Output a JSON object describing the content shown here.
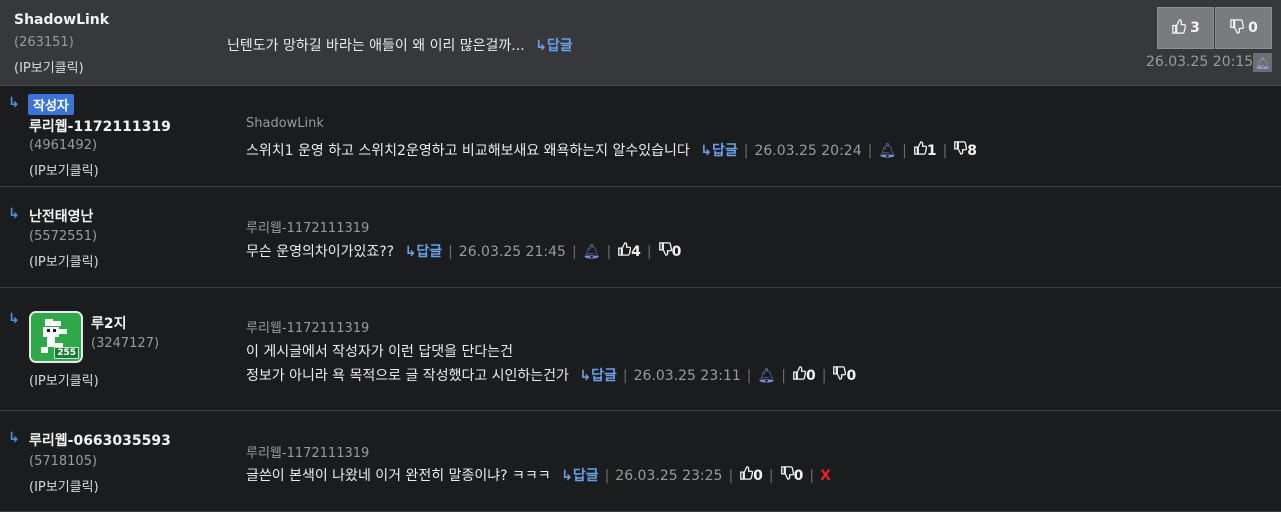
{
  "main_post": {
    "nick": "ShadowLink",
    "uid": "(263151)",
    "ip": "(IP보기클릭)",
    "text": "닌텐도가 망하길 바라는 애들이 왜 이리 많은걸까...",
    "reply_label": "답글",
    "up_count": "3",
    "down_count": "0",
    "date": "26.03.25 20:15"
  },
  "comments": [
    {
      "badge": "작성자",
      "nick": "루리웹-1172111319",
      "uid": "(4961492)",
      "ip": "(IP보기클릭)",
      "parent": "ShadowLink",
      "text_lines": [
        "스위치1 운영 하고 스위치2운영하고 비교해보새요 왜욕하는지 알수있습니다"
      ],
      "reply_label": "답글",
      "date": "26.03.25 20:24",
      "up": "1",
      "down": "8"
    },
    {
      "nick": "난전태영난",
      "uid": "(5572551)",
      "ip": "(IP보기클릭)",
      "parent": "루리웹-1172111319",
      "text_lines": [
        "무슨 운영의차이가있죠??"
      ],
      "reply_label": "답글",
      "date": "26.03.25 21:45",
      "up": "4",
      "down": "0"
    },
    {
      "nick": "루2지",
      "uid": "(3247127)",
      "ip": "(IP보기클릭)",
      "avatar_level": "255",
      "parent": "루리웹-1172111319",
      "text_lines": [
        "이 게시글에서 작성자가 이런 답댓을 단다는건",
        "정보가 아니라 욕 목적으로 글 작성했다고 시인하는건가"
      ],
      "reply_label": "답글",
      "date": "26.03.25 23:11",
      "up": "0",
      "down": "0"
    },
    {
      "nick": "루리웹-0663035593",
      "uid": "(5718105)",
      "ip": "(IP보기클릭)",
      "parent": "루리웹-1172111319",
      "text_lines": [
        "글쓴이 본색이 나왔네 이거 완전히 말종이냐? ㅋㅋㅋ"
      ],
      "reply_label": "답글",
      "date": "26.03.25 23:25",
      "up": "0",
      "down": "0",
      "delete_label": "X"
    }
  ],
  "icons": {
    "reply_arrow": "reply-arrow-icon",
    "thumb_up": "thumbs-up-icon",
    "thumb_down": "thumbs-down-icon",
    "bell": "report-bell-icon"
  },
  "colors": {
    "accent": "#6aa0e8",
    "badge": "#3b74d6",
    "delete": "#e0241f"
  }
}
